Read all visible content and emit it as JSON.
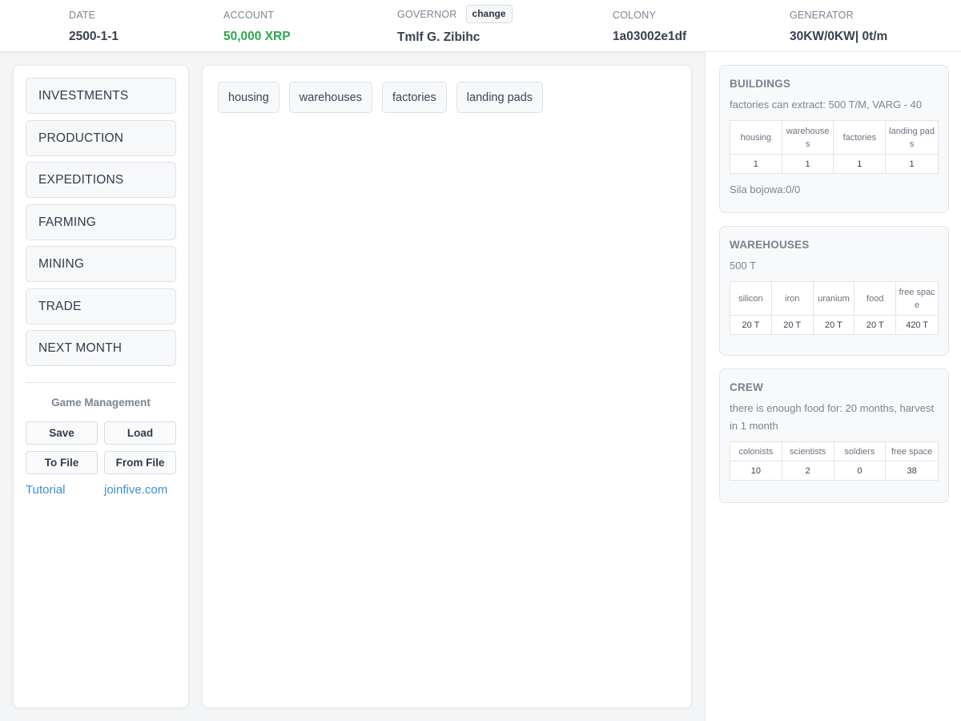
{
  "header": {
    "date": {
      "label": "DATE",
      "value": "2500-1-1"
    },
    "account": {
      "label": "ACCOUNT",
      "value": "50,000 XRP"
    },
    "governor": {
      "label": "GOVERNOR",
      "value": "Tmlf G. Zibihc",
      "change_label": "change"
    },
    "colony": {
      "label": "COLONY",
      "value": "1a03002e1df"
    },
    "generator": {
      "label": "GENERATOR",
      "value": "30KW/0KW| 0t/m"
    }
  },
  "nav": {
    "items": [
      {
        "label": "INVESTMENTS"
      },
      {
        "label": "PRODUCTION"
      },
      {
        "label": "EXPEDITIONS"
      },
      {
        "label": "FARMING"
      },
      {
        "label": "MINING"
      },
      {
        "label": "TRADE"
      },
      {
        "label": "NEXT MONTH"
      }
    ]
  },
  "game_management": {
    "title": "Game Management",
    "save": "Save",
    "load": "Load",
    "to_file": "To File",
    "from_file": "From File",
    "tutorial": "Tutorial",
    "site": "joinfive.com"
  },
  "tabs": [
    {
      "label": "housing"
    },
    {
      "label": "warehouses"
    },
    {
      "label": "factories"
    },
    {
      "label": "landing pads"
    }
  ],
  "buildings": {
    "title": "BUILDINGS",
    "info": "factories can extract: 500 T/M, VARG - 40",
    "headers": [
      "housing",
      "warehouses",
      "factories",
      "landing pads"
    ],
    "values": [
      "1",
      "1",
      "1",
      "1"
    ],
    "combat": "Sila bojowa:0/0"
  },
  "warehouses": {
    "title": "WAREHOUSES",
    "capacity": "500 T",
    "headers": [
      "silicon",
      "iron",
      "uranium",
      "food",
      "free space"
    ],
    "values": [
      "20 T",
      "20 T",
      "20 T",
      "20 T",
      "420 T"
    ]
  },
  "crew": {
    "title": "CREW",
    "info": "there is enough food for: 20 months, harvest in 1 month",
    "headers": [
      "colonists",
      "scientists",
      "soldiers",
      "free space"
    ],
    "values": [
      "10",
      "2",
      "0",
      "38"
    ]
  },
  "colors": {
    "account_green": "#2fa84f",
    "link_blue": "#3d8fd1",
    "background": "#f4f5f7"
  }
}
